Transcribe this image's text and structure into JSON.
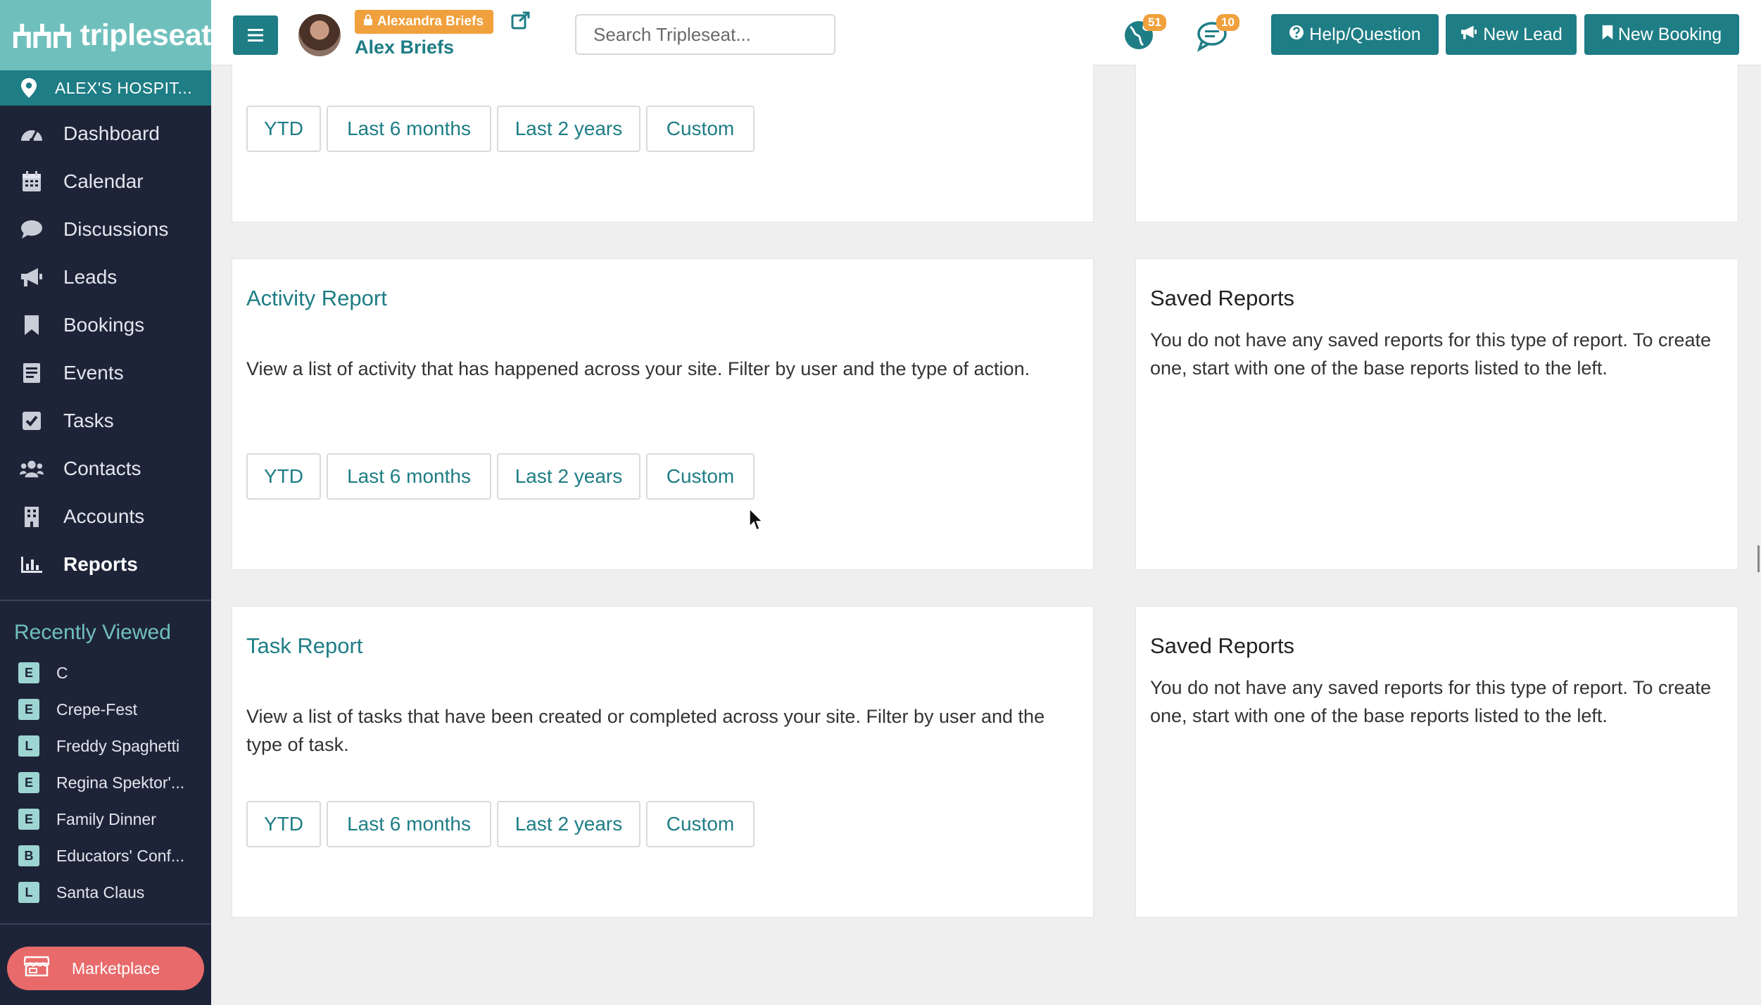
{
  "brand": {
    "logo_text": "tripleseat"
  },
  "venue": {
    "label": "ALEX'S HOSPIT..."
  },
  "sidebar": {
    "items": [
      {
        "label": "Dashboard",
        "icon": "dashboard-icon"
      },
      {
        "label": "Calendar",
        "icon": "calendar-icon"
      },
      {
        "label": "Discussions",
        "icon": "chat-icon"
      },
      {
        "label": "Leads",
        "icon": "megaphone-icon"
      },
      {
        "label": "Bookings",
        "icon": "bookmark-icon"
      },
      {
        "label": "Events",
        "icon": "document-icon"
      },
      {
        "label": "Tasks",
        "icon": "checkbox-icon"
      },
      {
        "label": "Contacts",
        "icon": "people-icon"
      },
      {
        "label": "Accounts",
        "icon": "building-icon"
      },
      {
        "label": "Reports",
        "icon": "bar-chart-icon"
      }
    ],
    "active": "Reports"
  },
  "recently_viewed": {
    "title": "Recently Viewed",
    "items": [
      {
        "badge": "E",
        "label": "C"
      },
      {
        "badge": "E",
        "label": "Crepe-Fest"
      },
      {
        "badge": "L",
        "label": "Freddy Spaghetti"
      },
      {
        "badge": "E",
        "label": "Regina Spektor'..."
      },
      {
        "badge": "E",
        "label": "Family Dinner"
      },
      {
        "badge": "B",
        "label": "Educators' Conf..."
      },
      {
        "badge": "L",
        "label": "Santa Claus"
      }
    ]
  },
  "marketplace": {
    "label": "Marketplace"
  },
  "topbar": {
    "impersonation_badge": "Alexandra Briefs",
    "user_name": "Alex Briefs",
    "search_placeholder": "Search Tripleseat...",
    "notifications_count": "51",
    "messages_count": "10",
    "help_label": "Help/Question",
    "new_lead_label": "New Lead",
    "new_booking_label": "New Booking"
  },
  "reports": [
    {
      "buttons": [
        "YTD",
        "Last 6 months",
        "Last 2 years",
        "Custom"
      ]
    },
    {
      "title": "Activity Report",
      "description": "View a list of activity that has happened across your site. Filter by user and the type of action.",
      "buttons": [
        "YTD",
        "Last 6 months",
        "Last 2 years",
        "Custom"
      ],
      "saved_title": "Saved Reports",
      "saved_description": "You do not have any saved reports for this type of report. To create one, start with one of the base reports listed to the left."
    },
    {
      "title": "Task Report",
      "description": "View a list of tasks that have been created or completed across your site. Filter by user and the type of task.",
      "buttons": [
        "YTD",
        "Last 6 months",
        "Last 2 years",
        "Custom"
      ],
      "saved_title": "Saved Reports",
      "saved_description": "You do not have any saved reports for this type of report. To create one, start with one of the base reports listed to the left."
    }
  ],
  "colors": {
    "teal": "#1e7d85",
    "logo_teal": "#6fc0bd",
    "sidebar_bg": "#1e2438",
    "badge_orange": "#f0a03c",
    "marketplace_red": "#e86a6a"
  }
}
